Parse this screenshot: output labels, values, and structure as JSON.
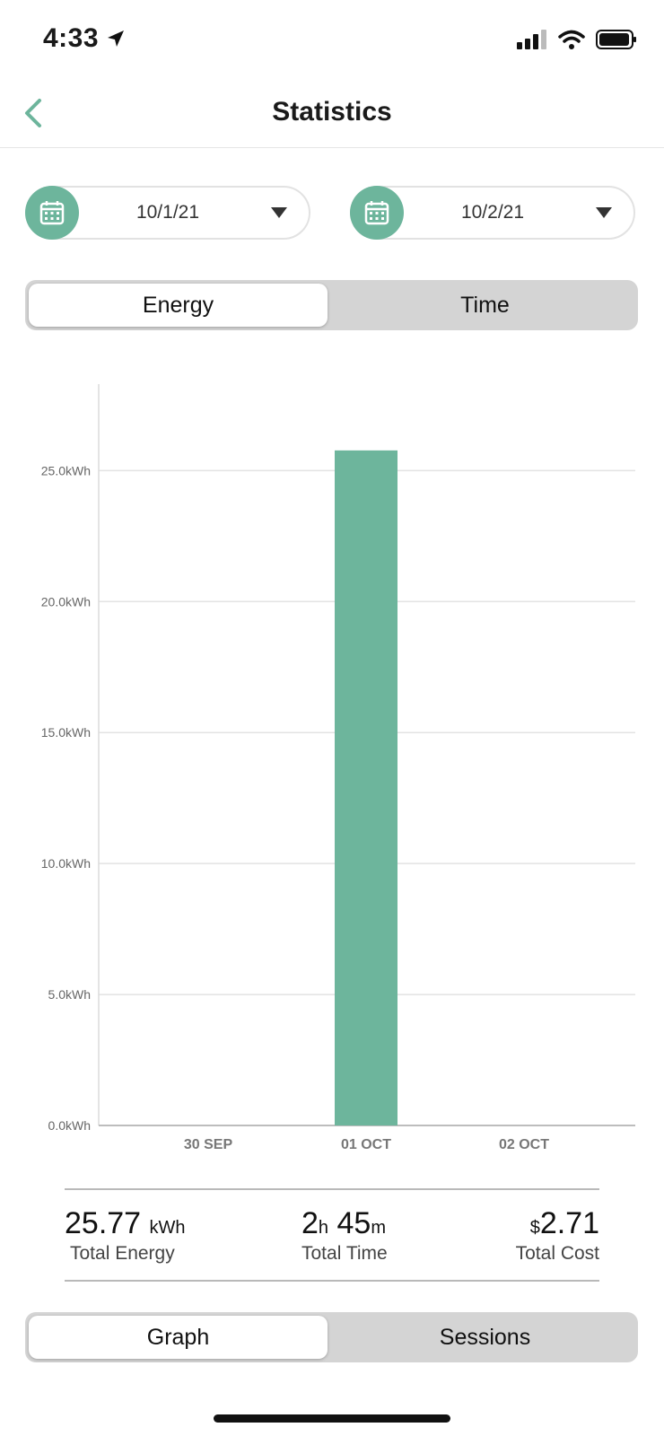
{
  "status_bar": {
    "time": "4:33"
  },
  "header": {
    "title": "Statistics"
  },
  "date_range": {
    "start": "10/1/21",
    "end": "10/2/21"
  },
  "metric_toggle": {
    "options": [
      "Energy",
      "Time"
    ],
    "selected": "Energy"
  },
  "chart_data": {
    "type": "bar",
    "categories": [
      "30 SEP",
      "01 OCT",
      "02 OCT"
    ],
    "values": [
      0,
      25.77,
      0
    ],
    "y_ticks": [
      "0.0kWh",
      "5.0kWh",
      "10.0kWh",
      "15.0kWh",
      "20.0kWh",
      "25.0kWh"
    ],
    "ylim": [
      0,
      28.3
    ],
    "grid": true,
    "color": "#6db59c"
  },
  "summary": {
    "energy": {
      "value": "25.77",
      "unit": "kWh",
      "label": "Total Energy"
    },
    "time": {
      "hours": "2",
      "hours_unit": "h",
      "minutes": "45",
      "minutes_unit": "m",
      "label": "Total Time"
    },
    "cost": {
      "currency": "$",
      "value": "2.71",
      "label": "Total Cost"
    }
  },
  "view_toggle": {
    "options": [
      "Graph",
      "Sessions"
    ],
    "selected": "Graph"
  },
  "colors": {
    "accent": "#6db59c"
  }
}
